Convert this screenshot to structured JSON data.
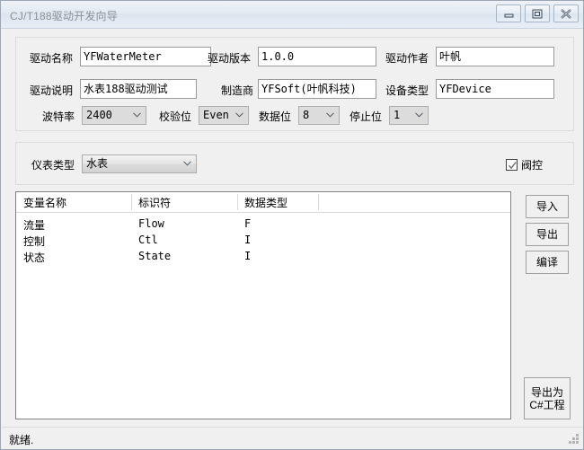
{
  "window": {
    "title": "CJ/T188驱动开发向导",
    "controls": [
      {
        "name": "minimize-button",
        "icon": "minimize-icon"
      },
      {
        "name": "restore-button",
        "icon": "restore-icon"
      },
      {
        "name": "close-button",
        "icon": "close-icon"
      }
    ]
  },
  "connection_group": {
    "fields": [
      {
        "label": "驱动名称",
        "value": "YFWaterMeter"
      },
      {
        "label": "驱动版本",
        "value": "1.0.0"
      },
      {
        "label": "驱动作者",
        "value": "叶帆"
      },
      {
        "label": "驱动说明",
        "value": "水表188驱动测试"
      },
      {
        "label": "制造商",
        "value": "YFSoft(叶帆科技)"
      },
      {
        "label": "设备类型",
        "value": "YFDevice"
      }
    ],
    "serial": [
      {
        "label": "波特率",
        "value": "2400"
      },
      {
        "label": "校验位",
        "value": "Even"
      },
      {
        "label": "数据位",
        "value": "8"
      },
      {
        "label": "停止位",
        "value": "1"
      }
    ]
  },
  "meter_group": {
    "type_label": "仪表类型",
    "type_value": "水表",
    "valve_label": "阀控",
    "valve_checked": true
  },
  "variable_list": {
    "columns": [
      "变量名称",
      "标识符",
      "数据类型",
      ""
    ],
    "rows": [
      {
        "name": "流量",
        "ident": "Flow",
        "type": "F"
      },
      {
        "name": "控制",
        "ident": "Ctl",
        "type": "I"
      },
      {
        "name": "状态",
        "ident": "State",
        "type": "I"
      }
    ]
  },
  "buttons": {
    "import": "导入",
    "export": "导出",
    "compile": "编译",
    "export_csharp": "导出为\nC#工程"
  },
  "statusbar": {
    "text": "就绪."
  }
}
